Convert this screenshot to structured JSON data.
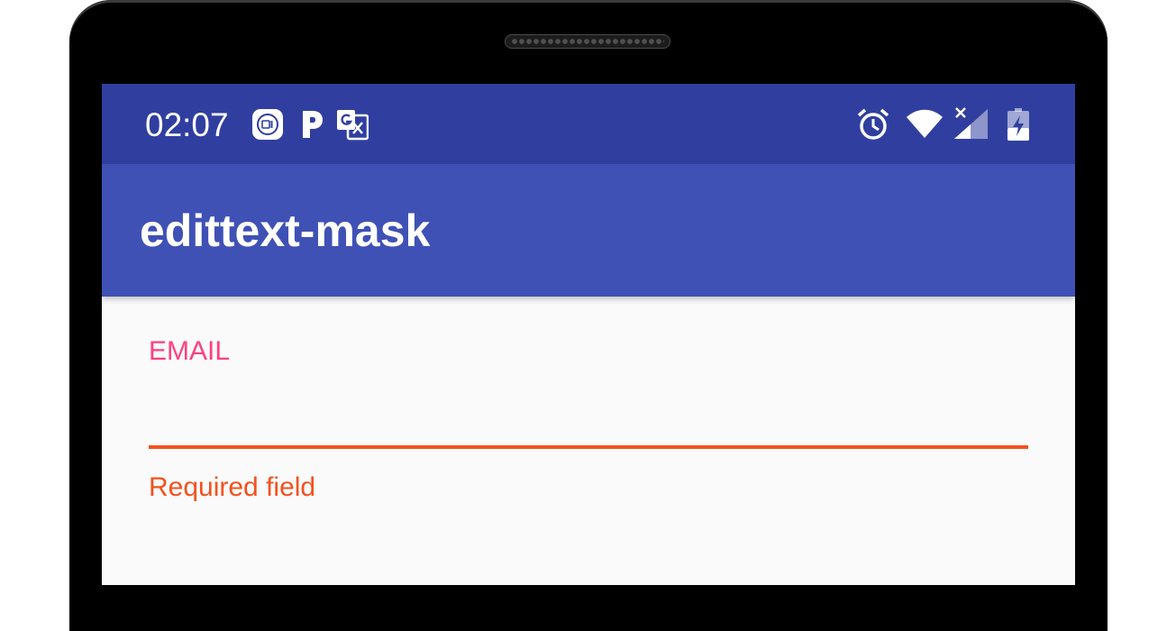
{
  "status_bar": {
    "time": "02:07",
    "notification_icons": [
      "mi-icon",
      "paypal-icon",
      "google-translate-icon"
    ],
    "system_icons": [
      "alarm-icon",
      "wifi-icon",
      "cellular-no-signal-icon",
      "battery-charging-icon"
    ]
  },
  "app_bar": {
    "title": "edittext-mask"
  },
  "form": {
    "email": {
      "label": "EMAIL",
      "value": "",
      "error": "Required field"
    }
  },
  "colors": {
    "status_bar": "#303f9f",
    "app_bar": "#3f51b5",
    "accent": "#ff4081",
    "error": "#f4511e",
    "background": "#fafafa"
  }
}
